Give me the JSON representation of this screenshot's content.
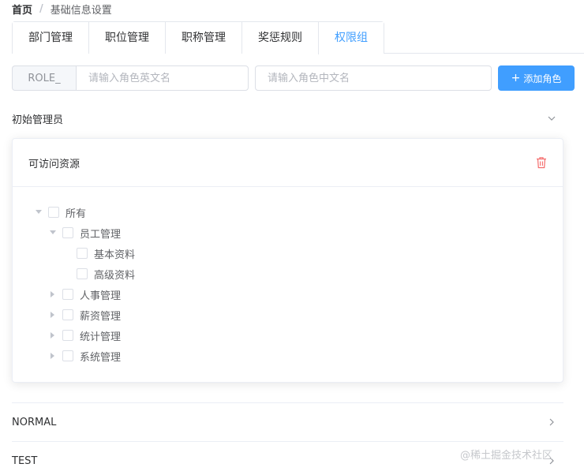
{
  "breadcrumb": {
    "home": "首页",
    "separator": "/",
    "current": "基础信息设置"
  },
  "tabs": [
    {
      "label": "部门管理",
      "active": false
    },
    {
      "label": "职位管理",
      "active": false
    },
    {
      "label": "职称管理",
      "active": false
    },
    {
      "label": "奖惩规则",
      "active": false
    },
    {
      "label": "权限组",
      "active": true
    }
  ],
  "role_form": {
    "prefix": "ROLE_",
    "en_placeholder": "请输入角色英文名",
    "cn_placeholder": "请输入角色中文名",
    "add_label": "添加角色"
  },
  "roles": [
    {
      "name": "初始管理员",
      "expanded": true
    },
    {
      "name": "NORMAL",
      "expanded": false
    },
    {
      "name": "TEST",
      "expanded": false
    }
  ],
  "card": {
    "title": "可访问资源"
  },
  "tree": {
    "root": "所有",
    "group_open": "员工管理",
    "children_open": [
      "基本资料",
      "高级资料"
    ],
    "groups_closed": [
      "人事管理",
      "薪资管理",
      "统计管理",
      "系统管理"
    ]
  },
  "watermark": "@稀土掘金技术社区",
  "colors": {
    "primary": "#409eff",
    "danger": "#f56c6c",
    "border": "#dcdfe6"
  }
}
